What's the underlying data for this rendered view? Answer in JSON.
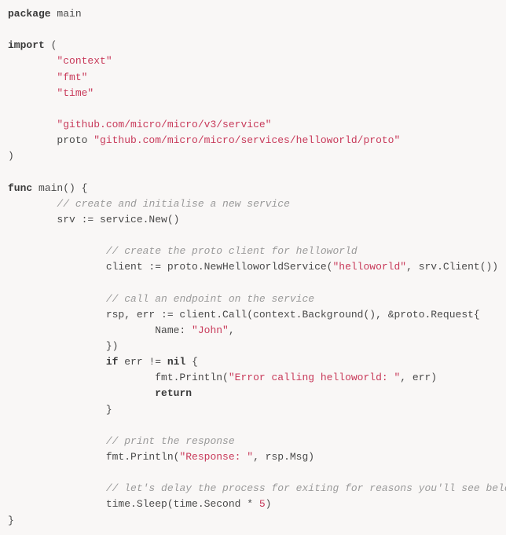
{
  "code": {
    "l1a": "package",
    "l1b": " main",
    "l3a": "import",
    "l3b": " (",
    "l4": "\"context\"",
    "l5": "\"fmt\"",
    "l6": "\"time\"",
    "l8": "\"github.com/micro/micro/v3/service\"",
    "l9a": "        proto ",
    "l9b": "\"github.com/micro/micro/services/helloworld/proto\"",
    "l10": ")",
    "l12a": "func",
    "l12b": " main() {",
    "l13": "// create and initialise a new service",
    "l14": "        srv := service.New()",
    "l16": "// create the proto client for helloworld",
    "l17a": "                client := proto.NewHelloworldService(",
    "l17b": "\"helloworld\"",
    "l17c": ", srv.Client())",
    "l19": "// call an endpoint on the service",
    "l20a": "                rsp, err := client.Call(context.Background(), ",
    "l20b": "&",
    "l20c": "proto.Request{",
    "l21a": "                        Name: ",
    "l21b": "\"John\"",
    "l21c": ",",
    "l22": "                })",
    "l23a": "if",
    "l23b": " err != ",
    "l23c": "nil",
    "l23d": " {",
    "l24a": "                        fmt.Println(",
    "l24b": "\"Error calling helloworld: \"",
    "l24c": ", err)",
    "l25": "return",
    "l26": "                }",
    "l28": "// print the response",
    "l29a": "                fmt.Println(",
    "l29b": "\"Response: \"",
    "l29c": ", rsp.Msg)",
    "l31": "// let's delay the process for exiting for reasons you'll see below",
    "l32a": "                time.Sleep(time.Second * ",
    "l32b": "5",
    "l32c": ")",
    "l33": "}"
  }
}
